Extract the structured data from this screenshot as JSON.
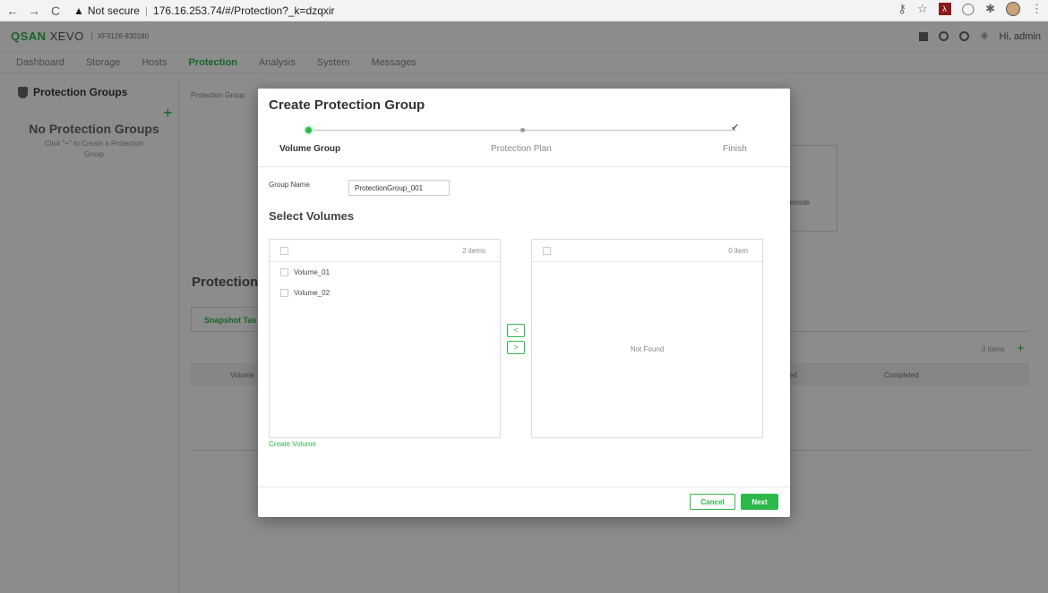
{
  "browser": {
    "back_glyph": "←",
    "forward_glyph": "→",
    "reload_glyph": "C",
    "warning_glyph": "▲",
    "not_secure": "Not secure",
    "url": "176.16.253.74/#/Protection?_k=dzqxir",
    "icons": [
      "key-icon",
      "star-icon",
      "pdf-extension-icon",
      "circle-extension-icon",
      "puzzle-extension-icon",
      "profile-avatar",
      "menu-icon"
    ]
  },
  "app": {
    "logo": "QSAN",
    "logo_suffix": "XEVO",
    "model": "XF3126-830180",
    "greeting": "Hi, admin",
    "nav": [
      "Dashboard",
      "Storage",
      "Hosts",
      "Protection",
      "Analysis",
      "System",
      "Messages"
    ],
    "active_nav": "Protection"
  },
  "sidebar": {
    "title": "Protection Groups",
    "empty_title": "No Protection Groups",
    "empty_hint": "Click \"+\" to Create a Protection Group"
  },
  "main": {
    "breadcrumb": "Protection Group",
    "remote_text": "emote",
    "section_title": "Protection V",
    "tab": "Snapshot Tas",
    "items_count": "0 items",
    "columns": [
      "Volume",
      "ed",
      "Completed"
    ]
  },
  "modal": {
    "title": "Create Protection Group",
    "steps": [
      "Volume Group",
      "Protection Plan",
      "Finish"
    ],
    "group_name_label": "Group Name",
    "group_name_value": "ProtectionGroup_001",
    "select_volumes_title": "Select Volumes",
    "left_count": "2 items",
    "right_count": "0 item",
    "volumes": [
      "Volume_01",
      "Volume_02"
    ],
    "not_found": "Not Found",
    "move_left": "<",
    "move_right": ">",
    "create_volume": "Create Volume",
    "cancel": "Cancel",
    "next": "Next"
  },
  "colors": {
    "accent": "#2db84b",
    "overlay": "rgba(0,0,0,0.45)"
  }
}
